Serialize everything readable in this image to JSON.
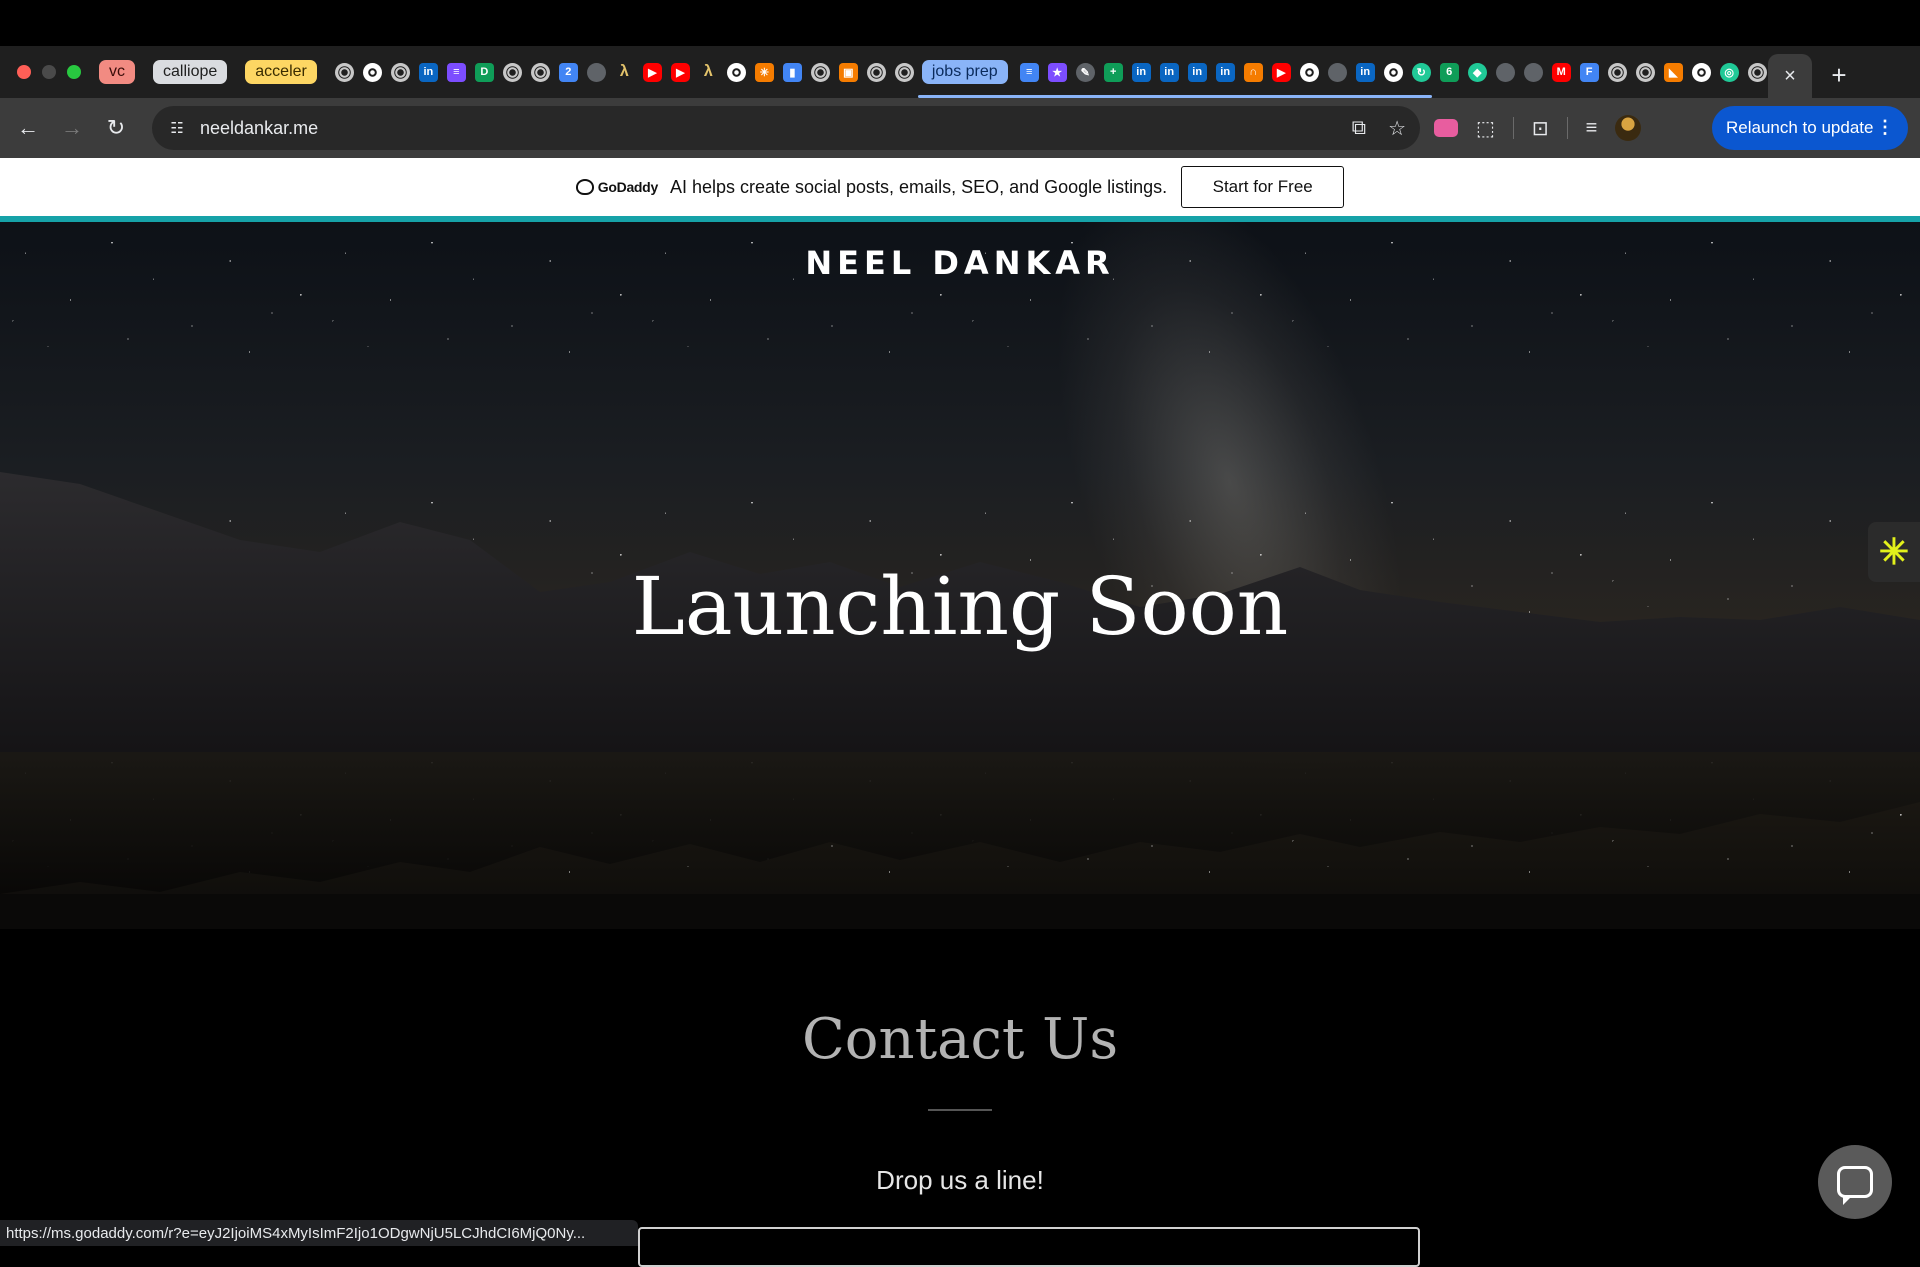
{
  "browser": {
    "tab_groups": [
      "vc",
      "calliope",
      "acceler",
      "jobs prep"
    ],
    "active_tab_close": "×",
    "new_tab": "+",
    "url": "neeldankar.me",
    "relaunch_label": "Relaunch to update",
    "status_url": "https://ms.godaddy.com/r?e=eyJ2IjoiMS4xMyIsImF2Ijo1ODgwNjU5LCJhdCI6MjQ0Ny...",
    "icons": {
      "back": "←",
      "forward": "→",
      "reload": "↻",
      "site_info": "☷",
      "install": "⧉",
      "bookmark": "☆",
      "extensions": "⬚",
      "tab_search": "⊡",
      "media": "≡",
      "menu": "⋮"
    }
  },
  "banner": {
    "logo_text": "GoDaddy",
    "message": "AI helps create social posts, emails, SEO, and Google listings.",
    "cta_label": "Start for Free"
  },
  "hero": {
    "brand": "NEEL DANKAR",
    "title": "Launching Soon",
    "widget_icon": "✳"
  },
  "contact": {
    "title": "Contact Us",
    "subtitle": "Drop us a line!"
  },
  "colors": {
    "accent_line": "#16a2a8",
    "relaunch_bg": "#0b57d0"
  }
}
